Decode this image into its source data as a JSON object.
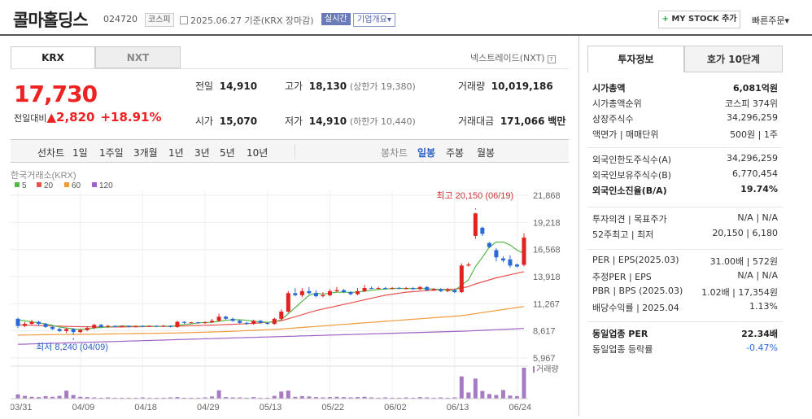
{
  "header": {
    "title": "콜마홀딩스",
    "code": "024720",
    "market": "코스피",
    "date": "2025.06.27",
    "basis": "기준(KRX 장마감)",
    "live": "실시간",
    "corp_info": "기업개요",
    "corp_caret": "▾",
    "mystock": "MY STOCK 추가",
    "mystock_plus": "+",
    "quick": "빠른주문",
    "quick_caret": "▾"
  },
  "exchange_tabs": [
    "KRX",
    "NXT"
  ],
  "nxt_label": "넥스트레이드(NXT)",
  "help_mark": "?",
  "price": {
    "current": "17,730",
    "change_label": "전일대비",
    "change_arrow": "▲",
    "change": "2,820",
    "rate": "+18.91%"
  },
  "quote": {
    "prev_label": "전일",
    "prev": "14,910",
    "high_label": "고가",
    "high": "18,130",
    "upper_limit": "(상한가 19,380)",
    "volume_label": "거래량",
    "volume": "10,019,186",
    "open_label": "시가",
    "open": "15,070",
    "low_label": "저가",
    "low": "14,910",
    "lower_limit": "(하한가 10,440)",
    "amount_label": "거래대금",
    "amount": "171,066",
    "amount_unit": "백만"
  },
  "period_bar": {
    "chart_label": "선차트",
    "periods": [
      "1일",
      "1주일",
      "3개월",
      "1년",
      "3년",
      "5년",
      "10년"
    ],
    "candle_label": "봉차트",
    "candles": [
      "일봉",
      "주봉",
      "월봉"
    ]
  },
  "chart": {
    "source": "한국거래소(KRX)",
    "ma_legend": [
      {
        "label": "5",
        "color": "#55b848"
      },
      {
        "label": "20",
        "color": "#e8514e"
      },
      {
        "label": "60",
        "color": "#f09a3a"
      },
      {
        "label": "120",
        "color": "#9f62c4"
      }
    ],
    "yticks": [
      "21,868",
      "19,218",
      "16,568",
      "13,918",
      "11,267",
      "8,617",
      "5,967"
    ],
    "xticks": [
      "03/31",
      "04/09",
      "04/18",
      "04/29",
      "05/13",
      "05/22",
      "06/02",
      "06/13",
      "06/24"
    ],
    "high_note": "최고 20,150 (06/19)",
    "low_note": "최저 8,240 (04/09)",
    "volume_label": "거래량"
  },
  "right": {
    "tabs": [
      "투자정보",
      "호가 10단계"
    ],
    "g1": [
      {
        "l": "시가총액",
        "r": "6,081억원"
      },
      {
        "l": "시가총액순위",
        "r": "코스피 374위"
      },
      {
        "l": "상장주식수",
        "r": "34,296,259"
      },
      {
        "l": "액면가 | 매매단위",
        "r": "500원 | 1주"
      }
    ],
    "g2": [
      {
        "l": "외국인한도주식수(A)",
        "r": "34,296,259"
      },
      {
        "l": "외국인보유주식수(B)",
        "r": "6,770,454"
      },
      {
        "l": "외국인소진율(B/A)",
        "r": "19.74%"
      }
    ],
    "g3": [
      {
        "l": "투자의견 | 목표주가",
        "r": "N/A | N/A"
      },
      {
        "l": "52주최고 | 최저",
        "r": "20,150 | 6,180"
      }
    ],
    "g4": [
      {
        "l": "PER | EPS(2025.03)",
        "r": "31.00배 | 572원"
      },
      {
        "l": "추정PER | EPS",
        "r": "N/A | N/A"
      },
      {
        "l": "PBR | BPS (2025.03)",
        "r": "1.02배 | 17,354원"
      },
      {
        "l": "배당수익률 | 2025.04",
        "r": "1.13%"
      }
    ],
    "g5": [
      {
        "l": "동일업종 PER",
        "r": "22.34배"
      },
      {
        "l": "동일업종 등락률",
        "r": "-0.47%"
      }
    ]
  },
  "colors": {
    "up": "#e22222",
    "down": "#2a6ad8",
    "ma5": "#55b848",
    "ma20": "#e8514e",
    "ma60": "#f09a3a",
    "ma120": "#9f62c4"
  },
  "chart_data": {
    "type": "candlestick",
    "ylim": [
      5967,
      21868
    ],
    "candles": [
      [
        9800,
        9100,
        9900,
        8900
      ],
      [
        9100,
        9300,
        9500,
        9000
      ],
      [
        9300,
        9500,
        9700,
        9200
      ],
      [
        9500,
        9300,
        9600,
        9100
      ],
      [
        9300,
        9000,
        9400,
        8900
      ],
      [
        9000,
        8800,
        9100,
        8700
      ],
      [
        8800,
        8600,
        8900,
        8500
      ],
      [
        8600,
        8800,
        8900,
        8400
      ],
      [
        8800,
        8500,
        8900,
        8240
      ],
      [
        8500,
        8700,
        8800,
        8400
      ],
      [
        8700,
        8900,
        9000,
        8600
      ],
      [
        8900,
        9200,
        9300,
        8800
      ],
      [
        9200,
        9000,
        9300,
        8900
      ],
      [
        9000,
        9100,
        9200,
        8900
      ],
      [
        9100,
        9050,
        9150,
        8950
      ],
      [
        9050,
        9100,
        9150,
        9000
      ],
      [
        9100,
        9000,
        9150,
        8950
      ],
      [
        9000,
        9100,
        9150,
        8950
      ],
      [
        9100,
        9050,
        9150,
        9000
      ],
      [
        9050,
        9100,
        9150,
        9000
      ],
      [
        9100,
        9050,
        9150,
        9000
      ],
      [
        9050,
        9100,
        9200,
        9000
      ],
      [
        9100,
        9000,
        9150,
        8950
      ],
      [
        9000,
        9500,
        9600,
        8900
      ],
      [
        9500,
        9400,
        9550,
        9300
      ],
      [
        9400,
        9450,
        9500,
        9350
      ],
      [
        9450,
        9400,
        9500,
        9300
      ],
      [
        9400,
        9450,
        9550,
        9300
      ],
      [
        9450,
        9600,
        9800,
        9400
      ],
      [
        9600,
        10000,
        10300,
        9500
      ],
      [
        10000,
        9800,
        10100,
        9700
      ],
      [
        9800,
        9600,
        9900,
        9500
      ],
      [
        9600,
        9400,
        9700,
        9300
      ],
      [
        9400,
        9300,
        9500,
        9200
      ],
      [
        9300,
        9600,
        9700,
        9200
      ],
      [
        9600,
        9400,
        9700,
        9300
      ],
      [
        9400,
        9300,
        9500,
        9200
      ],
      [
        9300,
        9800,
        9900,
        9200
      ],
      [
        9800,
        10500,
        10700,
        9700
      ],
      [
        10500,
        12300,
        12500,
        10400
      ],
      [
        12300,
        12100,
        12800,
        12000
      ],
      [
        12100,
        12500,
        12800,
        11900
      ],
      [
        12500,
        12300,
        12900,
        12200
      ],
      [
        12300,
        12000,
        12600,
        11900
      ],
      [
        12000,
        12100,
        12400,
        11900
      ],
      [
        12100,
        12500,
        12700,
        12000
      ],
      [
        12500,
        12600,
        12900,
        12400
      ],
      [
        12600,
        12400,
        12700,
        12300
      ],
      [
        12400,
        12200,
        12500,
        12100
      ],
      [
        12200,
        12500,
        12800,
        12100
      ],
      [
        12500,
        12800,
        13100,
        12400
      ],
      [
        12800,
        12750,
        12950,
        12700
      ],
      [
        12750,
        12800,
        12950,
        12700
      ],
      [
        12800,
        12750,
        12900,
        12700
      ],
      [
        12750,
        12800,
        12900,
        12650
      ],
      [
        12800,
        12750,
        12900,
        12700
      ],
      [
        12750,
        12800,
        12900,
        12650
      ],
      [
        12800,
        12700,
        12900,
        12600
      ],
      [
        12700,
        12900,
        13000,
        12600
      ],
      [
        12900,
        12600,
        13000,
        12500
      ],
      [
        12600,
        12700,
        12800,
        12500
      ],
      [
        12700,
        12500,
        12800,
        12400
      ],
      [
        12500,
        12600,
        12800,
        12400
      ],
      [
        12600,
        12400,
        12700,
        12300
      ],
      [
        12400,
        15000,
        15200,
        12300
      ],
      [
        15000,
        15100,
        15300,
        14900
      ],
      [
        17900,
        20100,
        20150,
        17600
      ],
      [
        18700,
        18100,
        18800,
        17900
      ],
      [
        17200,
        16800,
        17300,
        16700
      ],
      [
        16500,
        15800,
        16700,
        15400
      ],
      [
        15700,
        15500,
        15900,
        15300
      ],
      [
        15600,
        15000,
        16000,
        14800
      ],
      [
        15100,
        14910,
        15200,
        14800
      ],
      [
        15070,
        17730,
        18130,
        14910
      ]
    ],
    "ma5": [
      9700,
      9600,
      9500,
      9400,
      9300,
      9150,
      9000,
      8900,
      8800,
      8750,
      8800,
      8900,
      8950,
      9000,
      9050,
      9100,
      9080,
      9060,
      9070,
      9080,
      9070,
      9080,
      9060,
      9150,
      9250,
      9300,
      9400,
      9430,
      9450,
      9550,
      9650,
      9700,
      9700,
      9650,
      9550,
      9500,
      9450,
      9500,
      9700,
      10300,
      10900,
      11500,
      12100,
      12300,
      12200,
      12300,
      12400,
      12400,
      12380,
      12400,
      12500,
      12600,
      12650,
      12700,
      12760,
      12770,
      12760,
      12750,
      12760,
      12740,
      12700,
      12650,
      12600,
      12550,
      13100,
      13600,
      14900,
      15800,
      16800,
      17300,
      17300,
      17000,
      16500,
      16200
    ],
    "ma20": [
      9200,
      9180,
      9160,
      9140,
      9120,
      9100,
      9080,
      9060,
      9040,
      9030,
      9020,
      9010,
      9000,
      9000,
      9000,
      9000,
      9010,
      9020,
      9030,
      9040,
      9050,
      9060,
      9070,
      9080,
      9100,
      9120,
      9140,
      9160,
      9180,
      9200,
      9230,
      9260,
      9290,
      9320,
      9350,
      9400,
      9450,
      9520,
      9620,
      9800,
      10000,
      10200,
      10400,
      10600,
      10750,
      10900,
      11050,
      11200,
      11350,
      11500,
      11650,
      11800,
      11950,
      12100,
      12200,
      12300,
      12400,
      12450,
      12500,
      12550,
      12600,
      12650,
      12680,
      12700,
      12800,
      12950,
      13200,
      13400,
      13600,
      13800,
      13950,
      14100,
      14250,
      14400
    ],
    "ma60": [
      8200,
      8210,
      8220,
      8230,
      8240,
      8250,
      8255,
      8260,
      8265,
      8270,
      8280,
      8290,
      8300,
      8310,
      8320,
      8330,
      8340,
      8350,
      8360,
      8370,
      8380,
      8390,
      8400,
      8410,
      8430,
      8450,
      8470,
      8490,
      8510,
      8530,
      8550,
      8580,
      8610,
      8640,
      8670,
      8700,
      8730,
      8760,
      8800,
      8850,
      8900,
      8950,
      9000,
      9050,
      9100,
      9150,
      9200,
      9250,
      9300,
      9350,
      9400,
      9450,
      9500,
      9550,
      9600,
      9650,
      9700,
      9750,
      9800,
      9850,
      9900,
      9950,
      10000,
      10050,
      10100,
      10200,
      10300,
      10400,
      10500,
      10600,
      10700,
      10800,
      10900,
      11000
    ],
    "ma120": [
      7300,
      7320,
      7340,
      7360,
      7380,
      7400,
      7420,
      7440,
      7460,
      7480,
      7500,
      7520,
      7540,
      7560,
      7580,
      7600,
      7620,
      7640,
      7660,
      7680,
      7700,
      7720,
      7740,
      7760,
      7780,
      7800,
      7820,
      7840,
      7860,
      7880,
      7900,
      7920,
      7940,
      7960,
      7980,
      8000,
      8020,
      8040,
      8060,
      8080,
      8100,
      8120,
      8140,
      8160,
      8180,
      8200,
      8220,
      8240,
      8260,
      8280,
      8300,
      8320,
      8340,
      8360,
      8380,
      8400,
      8420,
      8440,
      8460,
      8480,
      8500,
      8520,
      8540,
      8560,
      8580,
      8610,
      8640,
      8670,
      8700,
      8730,
      8760,
      8790,
      8820,
      8850
    ],
    "volume": [
      14,
      9,
      6,
      5,
      8,
      6,
      9,
      26,
      12,
      6,
      5,
      4,
      3,
      4,
      3,
      3,
      3,
      3,
      4,
      3,
      3,
      3,
      4,
      5,
      3,
      3,
      3,
      4,
      7,
      27,
      5,
      4,
      4,
      3,
      5,
      3,
      3,
      9,
      23,
      26,
      6,
      8,
      7,
      5,
      4,
      5,
      6,
      5,
      4,
      5,
      6,
      4,
      3,
      4,
      3,
      3,
      4,
      3,
      5,
      4,
      3,
      4,
      3,
      4,
      72,
      20,
      65,
      25,
      15,
      12,
      28,
      10,
      8,
      100
    ]
  }
}
